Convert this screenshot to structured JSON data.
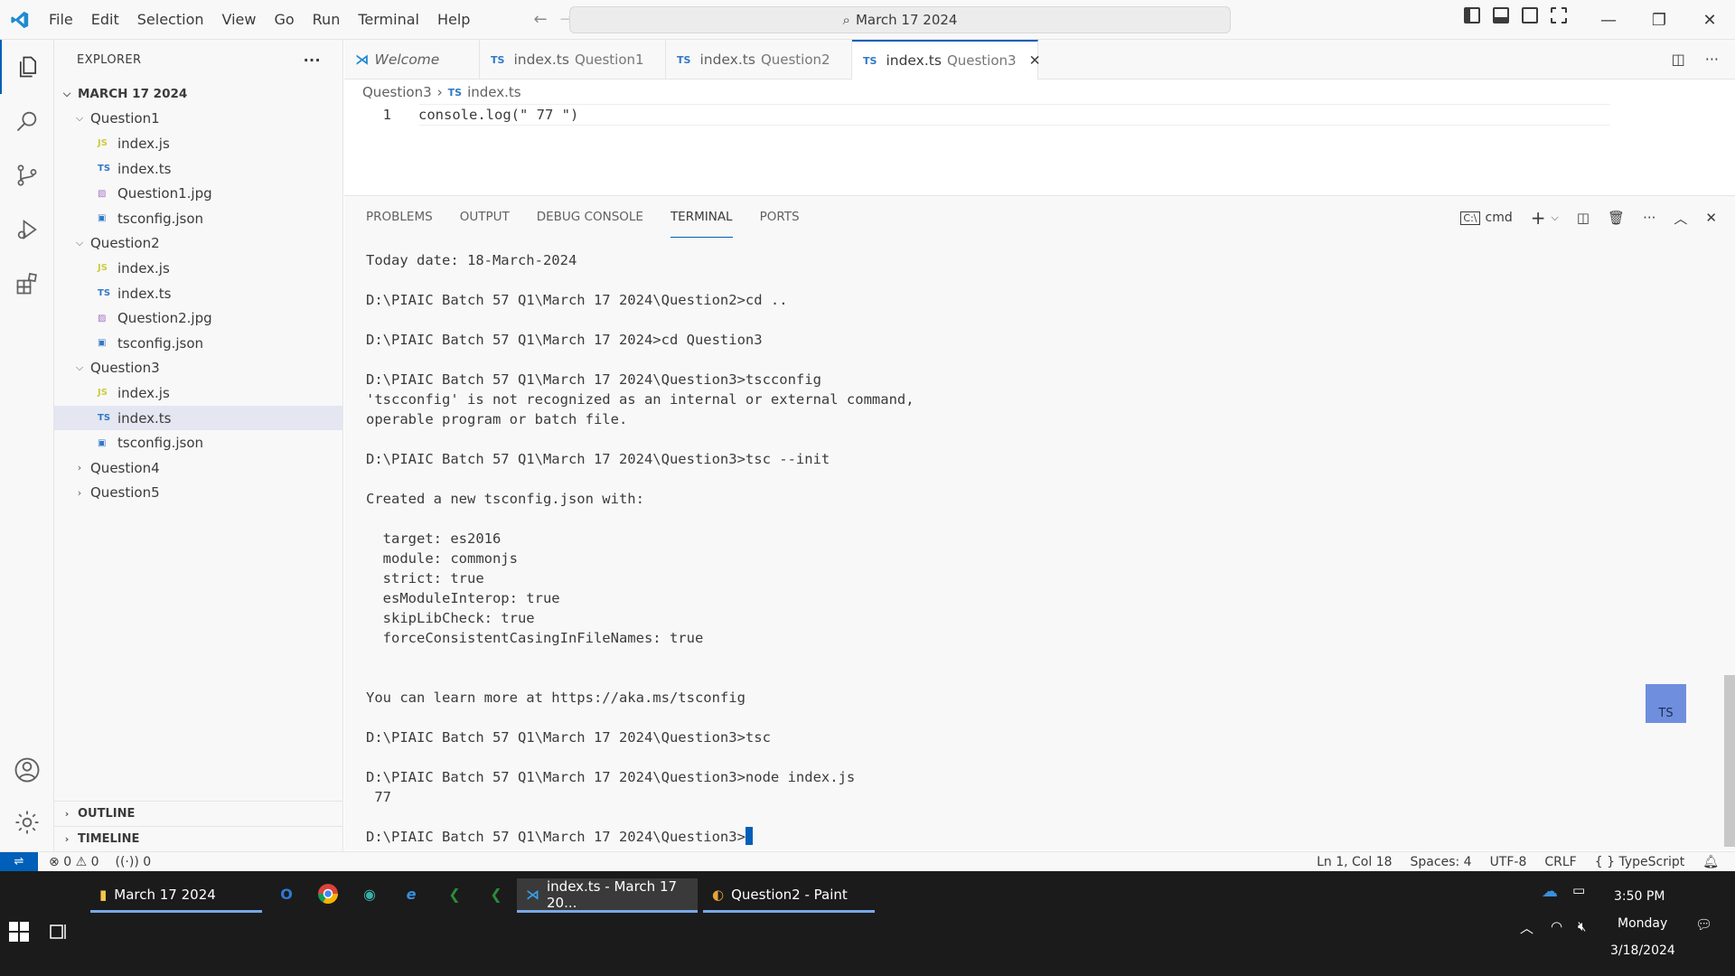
{
  "titlebar": {
    "menus": [
      "File",
      "Edit",
      "Selection",
      "View",
      "Go",
      "Run",
      "Terminal",
      "Help"
    ],
    "search_text": "March 17 2024"
  },
  "explorer": {
    "title": "EXPLORER",
    "more": "···",
    "root": "MARCH 17 2024",
    "folders": [
      {
        "name": "Question1",
        "files": [
          {
            "icon": "JS",
            "type": "js",
            "name": "index.js"
          },
          {
            "icon": "TS",
            "type": "ts",
            "name": "index.ts"
          },
          {
            "icon": "▨",
            "type": "img",
            "name": "Question1.jpg"
          },
          {
            "icon": "▣",
            "type": "json",
            "name": "tsconfig.json"
          }
        ]
      },
      {
        "name": "Question2",
        "files": [
          {
            "icon": "JS",
            "type": "js",
            "name": "index.js"
          },
          {
            "icon": "TS",
            "type": "ts",
            "name": "index.ts"
          },
          {
            "icon": "▨",
            "type": "img",
            "name": "Question2.jpg"
          },
          {
            "icon": "▣",
            "type": "json",
            "name": "tsconfig.json"
          }
        ]
      },
      {
        "name": "Question3",
        "files": [
          {
            "icon": "JS",
            "type": "js",
            "name": "index.js"
          },
          {
            "icon": "TS",
            "type": "ts",
            "name": "index.ts"
          },
          {
            "icon": "▣",
            "type": "json",
            "name": "tsconfig.json"
          }
        ]
      },
      {
        "name": "Question4"
      },
      {
        "name": "Question5"
      }
    ],
    "outline": "OUTLINE",
    "timeline": "TIMELINE"
  },
  "tabs": [
    {
      "label": "Welcome",
      "desc": ""
    },
    {
      "label": "index.ts",
      "desc": "Question1"
    },
    {
      "label": "index.ts",
      "desc": "Question2"
    },
    {
      "label": "index.ts",
      "desc": "Question3"
    }
  ],
  "breadcrumb": {
    "folder": "Question3",
    "file": "index.ts",
    "sep": "›",
    "badge": "TS"
  },
  "editor": {
    "line_number": "1",
    "code": "console.log(\" 77 \")"
  },
  "panel": {
    "tabs": [
      "PROBLEMS",
      "OUTPUT",
      "DEBUG CONSOLE",
      "TERMINAL",
      "PORTS"
    ],
    "shell": "cmd",
    "terminal_lines": [
      "Today date: 18-March-2024",
      "",
      "D:\\PIAIC Batch 57 Q1\\March 17 2024\\Question2>cd ..",
      "",
      "D:\\PIAIC Batch 57 Q1\\March 17 2024>cd Question3",
      "",
      "D:\\PIAIC Batch 57 Q1\\March 17 2024\\Question3>tscconfig",
      "'tscconfig' is not recognized as an internal or external command,",
      "operable program or batch file.",
      "",
      "D:\\PIAIC Batch 57 Q1\\March 17 2024\\Question3>tsc --init",
      "",
      "Created a new tsconfig.json with:",
      "",
      "  target: es2016",
      "  module: commonjs",
      "  strict: true",
      "  esModuleInterop: true",
      "  skipLibCheck: true",
      "  forceConsistentCasingInFileNames: true",
      "",
      "",
      "You can learn more at https://aka.ms/tsconfig",
      "",
      "D:\\PIAIC Batch 57 Q1\\March 17 2024\\Question3>tsc",
      "",
      "D:\\PIAIC Batch 57 Q1\\March 17 2024\\Question3>node index.js",
      " 77",
      ""
    ],
    "prompt": "D:\\PIAIC Batch 57 Q1\\March 17 2024\\Question3>",
    "drag_badge": "TS"
  },
  "statusbar": {
    "errors": "0",
    "warnings": "0",
    "ports": "0",
    "position": "Ln 1, Col 18",
    "spaces": "Spaces: 4",
    "encoding": "UTF-8",
    "eol": "CRLF",
    "language": "TypeScript"
  },
  "taskbar": {
    "explorer_window": "March 17 2024",
    "vscode_window": "index.ts - March 17 20...",
    "paint_window": "Question2 - Paint",
    "time": "3:50 PM",
    "day": "Monday",
    "date": "3/18/2024"
  },
  "colors": {
    "accent": "#005fb8",
    "taskbar": "#1b1b1b",
    "ts": "#3178c6",
    "js": "#cbcb41"
  }
}
